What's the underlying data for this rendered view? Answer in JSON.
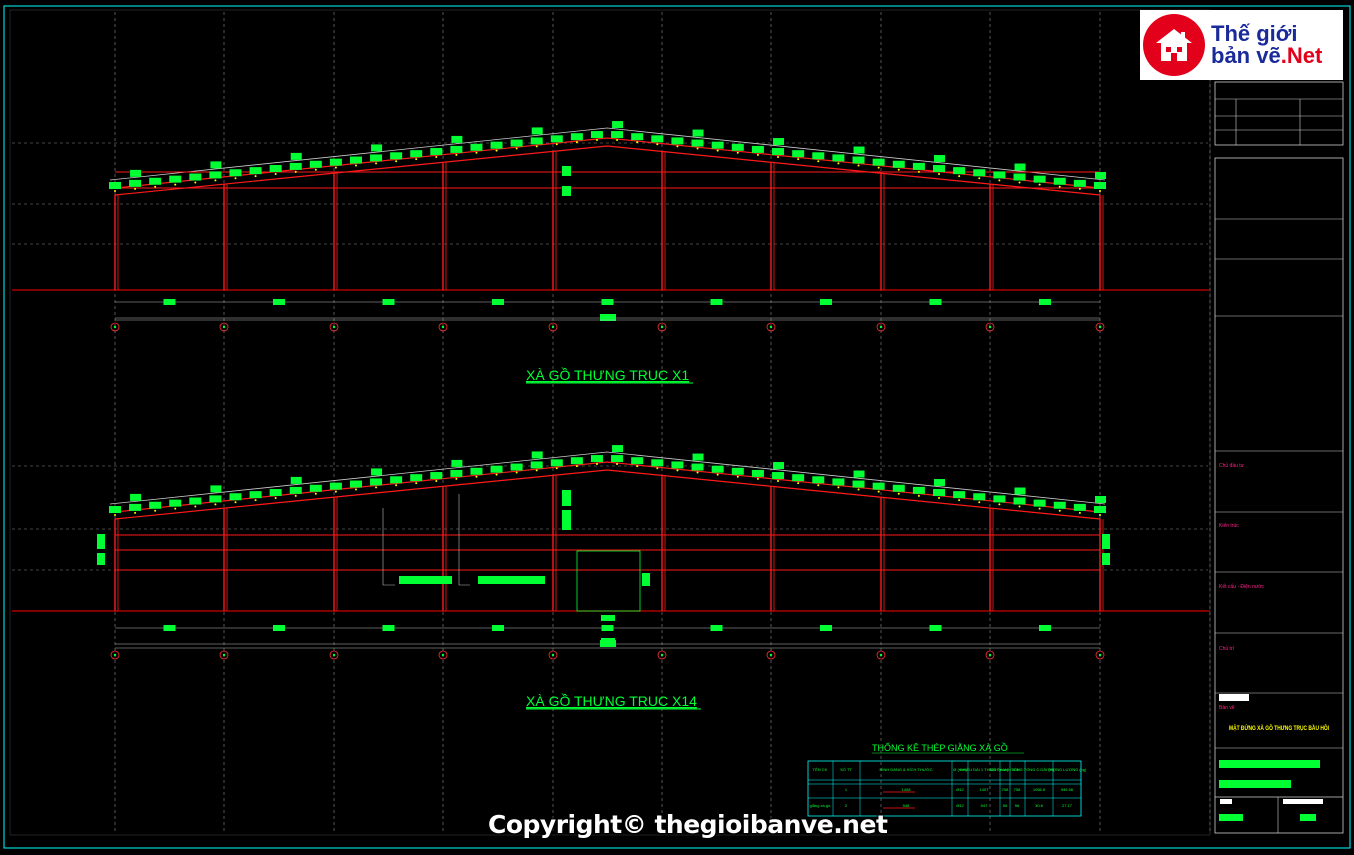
{
  "drawing": {
    "elevation_1_title": "XÀ GỒ THƯNG TRUC X1",
    "elevation_2_title": "XÀ GỒ THƯNG TRUC X14",
    "table_title": "THỐNG KÊ THÉP GIẰNG XÀ GỒ",
    "table_headers": [
      "TÊN CK",
      "SỐ TT",
      "HÌNH DẠNG & KÍCH THƯỚC",
      "Ø (mm)",
      "CHIỀU DÀI 1 THANH (mm)",
      "SỐ THANH 1CK",
      "TỔNG",
      "TỔNG C.DÀI (m)",
      "TRỌNG LƯỢNG (kg)"
    ],
    "table_rows": [
      {
        "name": "",
        "no": "1",
        "shape": "1408",
        "d": "Ø12",
        "len": "1407",
        "n1": "758",
        "n2": "758",
        "total_len": "1066.5",
        "weight": "946.56"
      },
      {
        "name": "giằng xà gồ",
        "no": "2",
        "shape": "548",
        "d": "Ø12",
        "len": "547",
        "n1": "56",
        "n2": "56",
        "total_len": "30.6",
        "weight": "27.17"
      }
    ],
    "title_block": {
      "labels": [
        "Chủ đầu tư",
        "Kiến trúc",
        "Kết cấu - Điện nước",
        "Chủ trì"
      ],
      "drawing_name": "MẶT ĐỨNG XÀ GỒ THƯNG TRỤC BẦU HỒI",
      "section_label": "Bản vẽ"
    }
  },
  "logo": {
    "line1": "Thế giới",
    "line2": "bản vẽ",
    "line2_suffix": ".Net"
  },
  "copyright": "Copyright© thegioibanve.net",
  "colors": {
    "background": "#000000",
    "structure": "#ff1a1a",
    "annotation": "#00ff33",
    "gridline": "#9a9a9a",
    "frame": "#00ffff"
  }
}
